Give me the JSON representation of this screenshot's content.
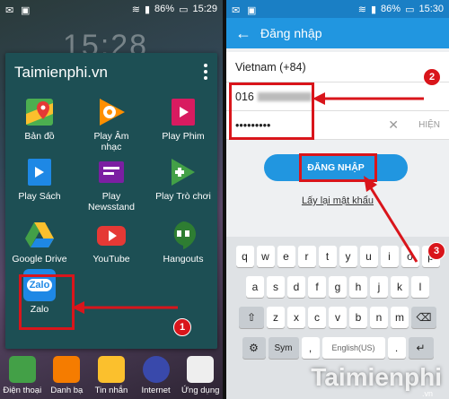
{
  "left": {
    "status": {
      "time": "15:29",
      "battery": "86%"
    },
    "clock": "15:28",
    "folder_title": "Taimienphi.vn",
    "apps": [
      {
        "label": "Bản đồ",
        "icon": "maps-icon",
        "color": "#4caf50"
      },
      {
        "label": "Play Âm\nnhạc",
        "icon": "play-music-icon",
        "color": "#ff8f00"
      },
      {
        "label": "Play Phim",
        "icon": "play-movies-icon",
        "color": "#d81b60"
      },
      {
        "label": "Play Sách",
        "icon": "play-books-icon",
        "color": "#1e88e5"
      },
      {
        "label": "Play\nNewsstand",
        "icon": "play-newsstand-icon",
        "color": "#7b1fa2"
      },
      {
        "label": "Play Trò chơi",
        "icon": "play-games-icon",
        "color": "#43a047"
      },
      {
        "label": "Google Drive",
        "icon": "drive-icon",
        "color": "#fbc02d"
      },
      {
        "label": "YouTube",
        "icon": "youtube-icon",
        "color": "#e53935"
      },
      {
        "label": "Hangouts",
        "icon": "hangouts-icon",
        "color": "#2e7d32"
      },
      {
        "label": "Zalo",
        "icon": "zalo-icon",
        "color": "#1e88e5"
      }
    ],
    "dock": [
      {
        "label": "Điện thoại",
        "icon": "phone-icon"
      },
      {
        "label": "Danh bạ",
        "icon": "contacts-icon"
      },
      {
        "label": "Tin nhắn",
        "icon": "messages-icon"
      },
      {
        "label": "Internet",
        "icon": "internet-icon"
      },
      {
        "label": "Ứng dụng",
        "icon": "apps-icon"
      }
    ],
    "step_badge": "1",
    "zalo_logo_text": "Zalo"
  },
  "right": {
    "status": {
      "time": "15:30",
      "battery": "86%"
    },
    "title": "Đăng nhập",
    "country": "Vietnam (+84)",
    "phone_value": "016",
    "password_mask": "•••••••••",
    "show_label": "HIỆN",
    "login_label": "ĐĂNG NHẬP",
    "forgot_label": "Lấy lại mật khẩu",
    "step_badge_2": "2",
    "step_badge_3": "3",
    "keyboard": {
      "row1": [
        "q",
        "w",
        "e",
        "r",
        "t",
        "y",
        "u",
        "i",
        "o",
        "p"
      ],
      "row2": [
        "a",
        "s",
        "d",
        "f",
        "g",
        "h",
        "j",
        "k",
        "l"
      ],
      "row3": [
        "z",
        "x",
        "c",
        "v",
        "b",
        "n",
        "m"
      ],
      "sym_label": "Sym",
      "lang_label": "English(US)"
    }
  },
  "watermark": {
    "text": "Taimienphi",
    "sub": ".vn"
  },
  "colors": {
    "accent": "#2196e0",
    "highlight": "#d9151b"
  }
}
